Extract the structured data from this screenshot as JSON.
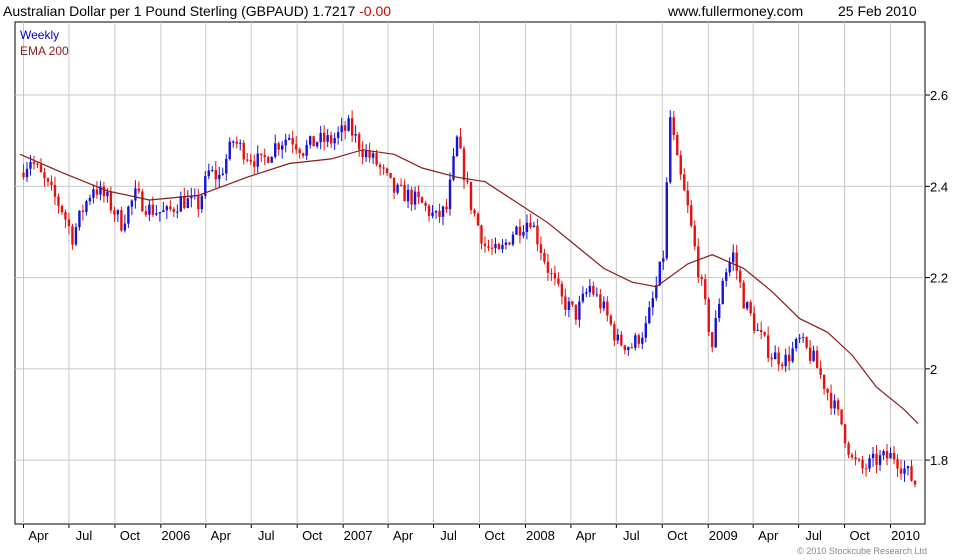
{
  "header": {
    "title": "Australian Dollar per 1 Pound Sterling (GBPAUD) 1.7217",
    "change": "-0.00",
    "site": "www.fullermoney.com",
    "date": "25 Feb 2010"
  },
  "footer": {
    "copyright": "© 2010 Stockcube Research Ltd"
  },
  "colors": {
    "up": "#1414d2",
    "down": "#e41111",
    "ema": "#8b1a1a",
    "grid": "#c8c8c8"
  },
  "chart_data": {
    "type": "candlestick",
    "title": "Australian Dollar per 1 Pound Sterling (GBPAUD)",
    "last_value": 1.7217,
    "change": -0.0,
    "legend": [
      "Weekly",
      "EMA 200"
    ],
    "legend_placement": "top-left",
    "grid": true,
    "x_range": [
      "2005-03-25",
      "2010-02-25"
    ],
    "ylim": [
      1.66,
      2.76
    ],
    "y_ticks": [
      1.8,
      2,
      2.2,
      2.4,
      2.6
    ],
    "y_tick_labels": [
      "1.8",
      "2",
      "2.2",
      "2.4",
      "2.6"
    ],
    "x_tick_labels": [
      "Apr",
      "Jul",
      "Oct",
      "2006",
      "Apr",
      "Jul",
      "Oct",
      "2007",
      "Apr",
      "Jul",
      "Oct",
      "2008",
      "Apr",
      "Jul",
      "Oct",
      "2009",
      "Apr",
      "Jul",
      "Oct",
      "2010"
    ],
    "series": [
      {
        "name": "Weekly",
        "close_approx": [
          [
            "2005-03-25",
            2.43
          ],
          [
            "2005-04-15",
            2.46
          ],
          [
            "2005-05-13",
            2.41
          ],
          [
            "2005-06-17",
            2.35
          ],
          [
            "2005-07-08",
            2.29
          ],
          [
            "2005-07-29",
            2.35
          ],
          [
            "2005-08-19",
            2.4
          ],
          [
            "2005-09-16",
            2.37
          ],
          [
            "2005-10-14",
            2.32
          ],
          [
            "2005-11-11",
            2.38
          ],
          [
            "2005-12-09",
            2.35
          ],
          [
            "2006-01-13",
            2.34
          ],
          [
            "2006-02-10",
            2.37
          ],
          [
            "2006-03-17",
            2.36
          ],
          [
            "2006-04-07",
            2.43
          ],
          [
            "2006-04-28",
            2.42
          ],
          [
            "2006-05-26",
            2.5
          ],
          [
            "2006-06-23",
            2.47
          ],
          [
            "2006-07-21",
            2.45
          ],
          [
            "2006-08-18",
            2.49
          ],
          [
            "2006-09-15",
            2.51
          ],
          [
            "2006-10-13",
            2.48
          ],
          [
            "2006-11-10",
            2.5
          ],
          [
            "2006-12-08",
            2.5
          ],
          [
            "2007-01-12",
            2.53
          ],
          [
            "2007-02-09",
            2.48
          ],
          [
            "2007-03-09",
            2.45
          ],
          [
            "2007-04-13",
            2.39
          ],
          [
            "2007-05-11",
            2.38
          ],
          [
            "2007-06-08",
            2.36
          ],
          [
            "2007-07-06",
            2.33
          ],
          [
            "2007-07-27",
            2.35
          ],
          [
            "2007-08-17",
            2.5
          ],
          [
            "2007-09-14",
            2.36
          ],
          [
            "2007-10-12",
            2.27
          ],
          [
            "2007-11-09",
            2.25
          ],
          [
            "2007-12-07",
            2.3
          ],
          [
            "2008-01-11",
            2.33
          ],
          [
            "2008-02-15",
            2.22
          ],
          [
            "2008-03-14",
            2.15
          ],
          [
            "2008-04-11",
            2.12
          ],
          [
            "2008-05-09",
            2.18
          ],
          [
            "2008-06-06",
            2.13
          ],
          [
            "2008-07-04",
            2.06
          ],
          [
            "2008-08-01",
            2.05
          ],
          [
            "2008-08-29",
            2.09
          ],
          [
            "2008-09-19",
            2.18
          ],
          [
            "2008-10-03",
            2.25
          ],
          [
            "2008-10-17",
            2.55
          ],
          [
            "2008-10-31",
            2.45
          ],
          [
            "2008-11-21",
            2.35
          ],
          [
            "2008-12-12",
            2.22
          ],
          [
            "2009-01-09",
            2.05
          ],
          [
            "2009-01-30",
            2.2
          ],
          [
            "2009-02-20",
            2.25
          ],
          [
            "2009-03-13",
            2.15
          ],
          [
            "2009-04-10",
            2.08
          ],
          [
            "2009-05-08",
            2.03
          ],
          [
            "2009-06-05",
            2.02
          ],
          [
            "2009-07-03",
            2.06
          ],
          [
            "2009-07-31",
            2.02
          ],
          [
            "2009-08-28",
            1.95
          ],
          [
            "2009-09-25",
            1.88
          ],
          [
            "2009-10-16",
            1.8
          ],
          [
            "2009-11-06",
            1.78
          ],
          [
            "2009-12-04",
            1.8
          ],
          [
            "2010-01-08",
            1.81
          ],
          [
            "2010-01-29",
            1.78
          ],
          [
            "2010-02-19",
            1.75
          ],
          [
            "2010-02-25",
            1.7217
          ]
        ]
      },
      {
        "name": "EMA 200",
        "values_approx": [
          [
            "2005-03-25",
            2.47
          ],
          [
            "2005-06-17",
            2.43
          ],
          [
            "2005-09-16",
            2.39
          ],
          [
            "2005-12-09",
            2.37
          ],
          [
            "2006-03-17",
            2.38
          ],
          [
            "2006-06-23",
            2.42
          ],
          [
            "2006-09-15",
            2.45
          ],
          [
            "2006-12-08",
            2.46
          ],
          [
            "2007-02-09",
            2.48
          ],
          [
            "2007-04-13",
            2.47
          ],
          [
            "2007-06-08",
            2.44
          ],
          [
            "2007-08-17",
            2.42
          ],
          [
            "2007-10-12",
            2.41
          ],
          [
            "2007-12-07",
            2.37
          ],
          [
            "2008-02-15",
            2.32
          ],
          [
            "2008-04-11",
            2.27
          ],
          [
            "2008-06-06",
            2.22
          ],
          [
            "2008-08-01",
            2.19
          ],
          [
            "2008-09-19",
            2.18
          ],
          [
            "2008-11-21",
            2.23
          ],
          [
            "2009-01-09",
            2.25
          ],
          [
            "2009-03-13",
            2.22
          ],
          [
            "2009-05-08",
            2.17
          ],
          [
            "2009-07-03",
            2.11
          ],
          [
            "2009-08-28",
            2.08
          ],
          [
            "2009-10-16",
            2.03
          ],
          [
            "2009-12-04",
            1.96
          ],
          [
            "2010-01-29",
            1.91
          ],
          [
            "2010-02-25",
            1.88
          ]
        ]
      }
    ]
  }
}
